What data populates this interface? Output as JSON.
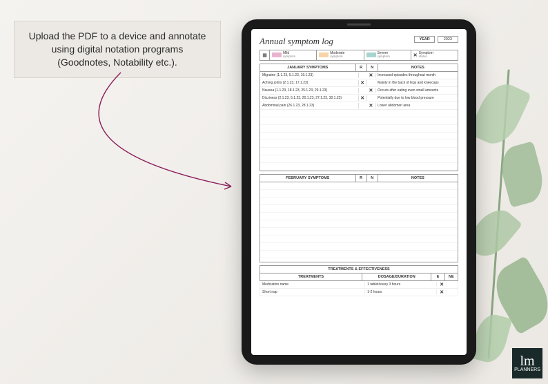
{
  "callout": "Upload the PDF to a device and annotate using digital notation programs (Goodnotes, Notability etc.).",
  "page_title": "Annual symptom log",
  "year": {
    "label": "YEAR",
    "value": "2023"
  },
  "legend": {
    "mild": {
      "top": "Mild",
      "bottom": "symptom"
    },
    "moderate": {
      "top": "Moderate",
      "bottom": "symptom"
    },
    "severe": {
      "top": "Severe",
      "bottom": "symptom"
    },
    "status": {
      "mark": "✕",
      "top": "Symptom",
      "bottom": "status"
    }
  },
  "january": {
    "heading": "JANUARY SYMPTOMS",
    "col_r": "R",
    "col_n": "N",
    "notes_heading": "NOTES",
    "rows": [
      {
        "symptom": "Migraine (1.1.23, 5.1.23, 19.1.23)",
        "r": "",
        "n": "✕",
        "note": "Increased episodes throughout month"
      },
      {
        "symptom": "Aching joints (2.1.23, 17.1.23)",
        "r": "✕",
        "n": "",
        "note": "Mainly in the back of legs and kneecaps"
      },
      {
        "symptom": "Nausea (1.1.23, 18.1.23, 25.1.23, 29.1.23)",
        "r": "",
        "n": "✕",
        "note": "Occurs after eating even small amounts"
      },
      {
        "symptom": "Dizziness (2.1.23, 5.1.23, 20.1.23, 27.1.23, 30.1.23)",
        "r": "✕",
        "n": "",
        "note": "Potentially due to low blood pressure"
      },
      {
        "symptom": "Abdominal pain (26.1.23, 28.1.23)",
        "r": "",
        "n": "✕",
        "note": "Lower abdomen area"
      }
    ]
  },
  "february": {
    "heading": "FEBRUARY SYMPTOMS",
    "col_r": "R",
    "col_n": "N",
    "notes_heading": "NOTES"
  },
  "treatments": {
    "title": "TREATMENTS & EFFECTIVENESS",
    "col_treat": "TREATMENTS",
    "col_dose": "DOSAGE/DURATION",
    "col_e": "E",
    "col_ne": "NE",
    "rows": [
      {
        "treatment": "Medication name",
        "dose": "1 tablet/every 3 hours",
        "e": "✕",
        "ne": ""
      },
      {
        "treatment": "Short nap",
        "dose": "1-2 hours",
        "e": "✕",
        "ne": ""
      }
    ]
  },
  "brand": {
    "logo": "lm",
    "sub": "PLANNERS"
  }
}
